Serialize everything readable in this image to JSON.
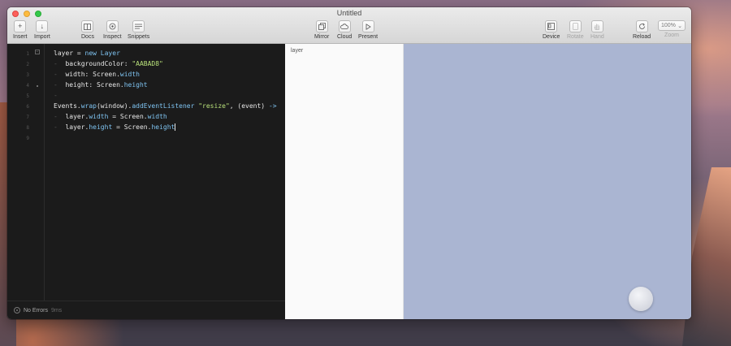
{
  "window": {
    "title": "Untitled"
  },
  "toolbar": {
    "insert": "Insert",
    "import": "Import",
    "docs": "Docs",
    "inspect": "Inspect",
    "snippets": "Snippets",
    "mirror": "Mirror",
    "cloud": "Cloud",
    "present": "Present",
    "device": "Device",
    "rotate": "Rotate",
    "hand": "Hand",
    "reload": "Reload",
    "zoom_label": "Zoom",
    "zoom_value": "100%"
  },
  "editor": {
    "line_numbers": [
      "1",
      "2",
      "3",
      "4",
      "5",
      "6",
      "7",
      "8",
      "9"
    ],
    "lines": {
      "l1_a": "layer = ",
      "l1_b": "new Layer",
      "l2_a": "backgroundColor: ",
      "l2_b": "\"AABAD8\"",
      "l3_a": "width: Screen.",
      "l3_b": "width",
      "l4_a": "height: Screen.",
      "l4_b": "height",
      "l6_a": "Events.",
      "l6_b": "wrap",
      "l6_c": "(window).",
      "l6_d": "addEventListener",
      "l6_e": " ",
      "l6_f": "\"resize\"",
      "l6_g": ", (event) ",
      "l6_h": "->",
      "l7_a": "layer.",
      "l7_b": "width",
      "l7_c": " = Screen.",
      "l7_d": "width",
      "l8_a": "layer.",
      "l8_b": "height",
      "l8_c": " = Screen.",
      "l8_d": "height"
    },
    "status": {
      "text": "No Errors",
      "time": "9ms"
    }
  },
  "preview": {
    "layer_name": "layer",
    "background": "#AAB5D2"
  }
}
